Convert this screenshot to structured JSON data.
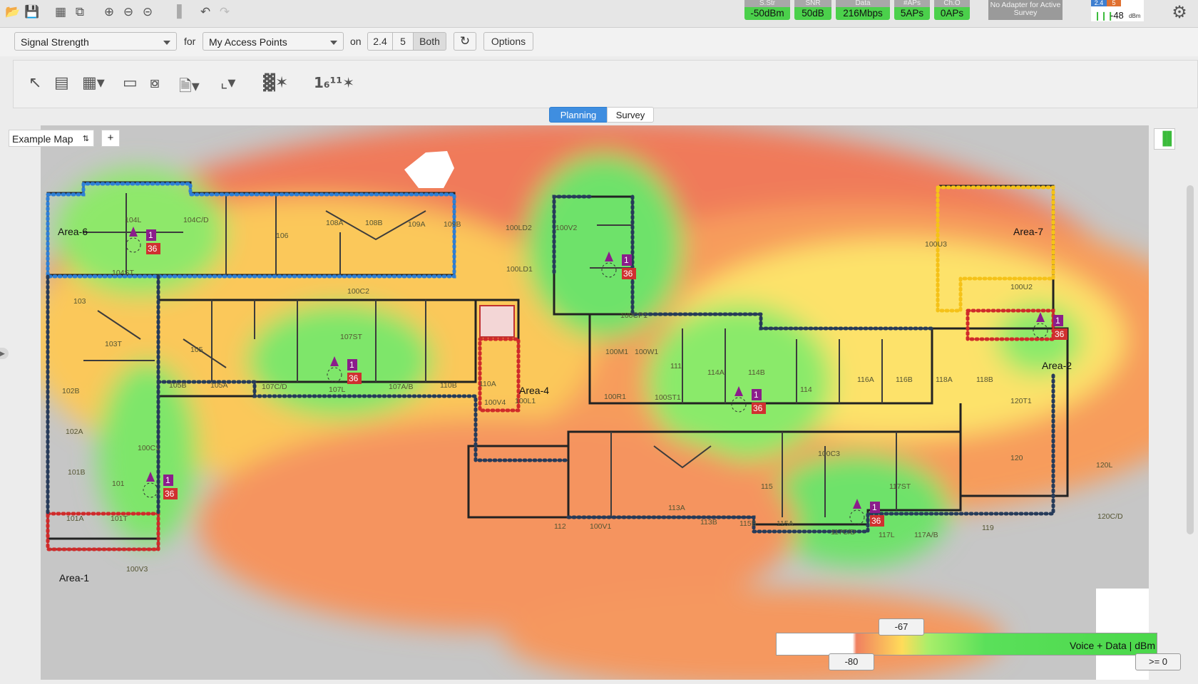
{
  "toolbar": {
    "icons": [
      "open-folder-icon",
      "save-icon",
      "grid-icon",
      "export-icon",
      "zoom-in-icon",
      "zoom-out-icon",
      "zoom-fit-icon",
      "bar-chart-icon",
      "undo-icon",
      "redo-icon"
    ],
    "stats": [
      {
        "label": "S.Str",
        "value": "-50dBm"
      },
      {
        "label": "SNR",
        "value": "50dB"
      },
      {
        "label": "Data",
        "value": "216Mbps"
      },
      {
        "label": "#APs",
        "value": "5APs"
      },
      {
        "label": "Ch.O",
        "value": "0APs"
      }
    ],
    "adapter_status": "No Adapter for Active Survey",
    "band_24": "2.4",
    "band_5": "5",
    "signal_value": "-48",
    "signal_unit": "dBm"
  },
  "controls": {
    "metric": "Signal Strength",
    "for_label": "for",
    "source": "My Access Points",
    "on_label": "on",
    "bands": [
      "2.4",
      "5",
      "Both"
    ],
    "options_label": "Options"
  },
  "tabs": [
    "Planning",
    "Survey"
  ],
  "map": {
    "selected": "Example Map",
    "add_label": "+",
    "areas": [
      "Area-6",
      "Area-7",
      "Area-2",
      "Area-4",
      "Area-1"
    ],
    "ap_channel": "1",
    "ap_power": "36"
  },
  "legend": {
    "label": "Voice + Data | dBm",
    "min": "-80",
    "threshold": "-67",
    "max": ">= 0"
  },
  "colors": {
    "accent": "#3f8ee0",
    "good": "#4bd04b",
    "ap_channel": "#8b1d8b",
    "ap_power": "#d03030"
  }
}
